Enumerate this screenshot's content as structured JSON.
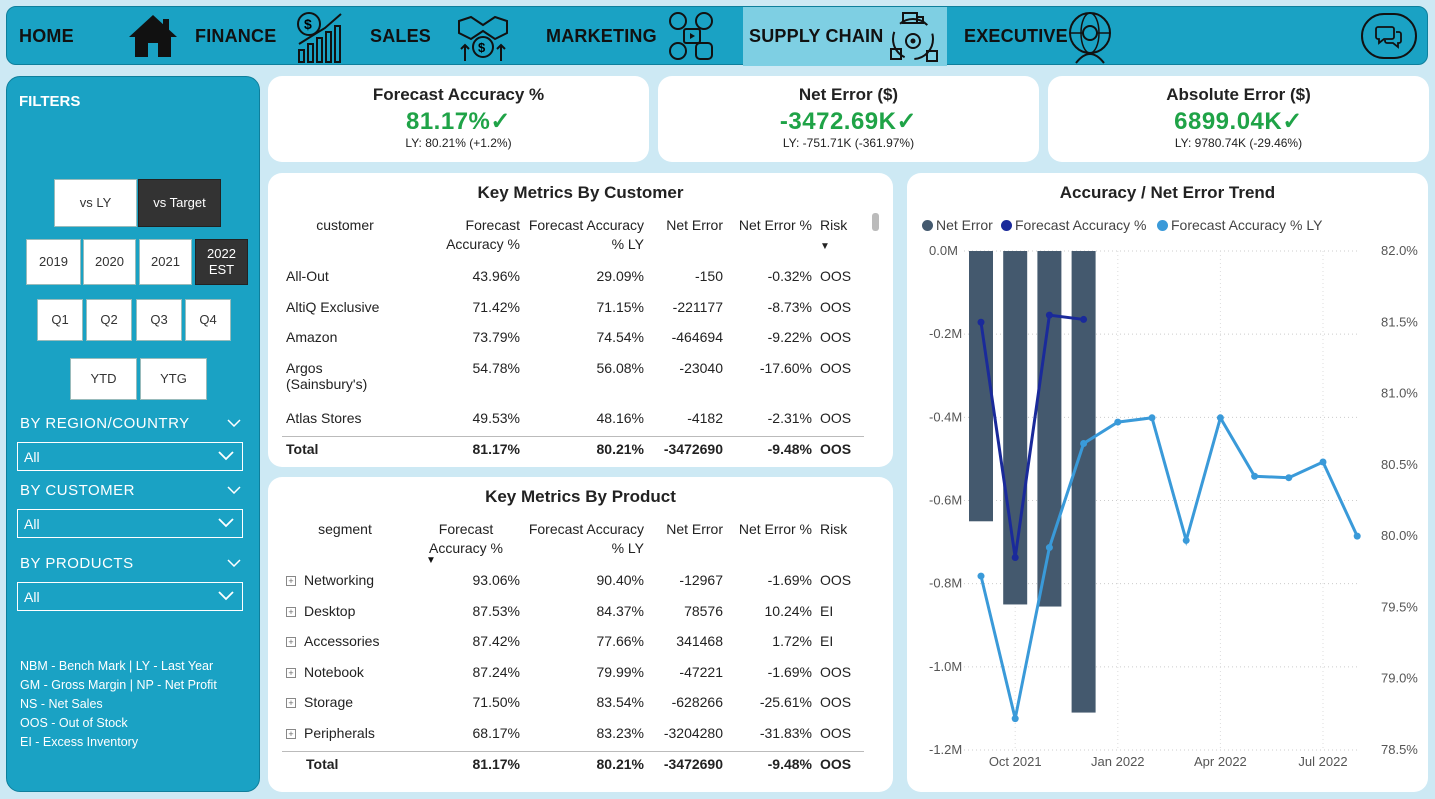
{
  "nav": {
    "items": [
      {
        "label": "HOME",
        "icon": "home-icon"
      },
      {
        "label": "FINANCE",
        "icon": "growth-chart-icon"
      },
      {
        "label": "SALES",
        "icon": "handshake-money-icon"
      },
      {
        "label": "MARKETING",
        "icon": "social-media-icon"
      },
      {
        "label": "SUPPLY CHAIN",
        "icon": "supply-chain-icon",
        "active": true
      },
      {
        "label": "EXECUTIVE",
        "icon": "executive-icon"
      }
    ],
    "help_icon": "chat-help-icon"
  },
  "filters": {
    "title": "FILTERS",
    "compare": [
      "vs LY",
      "vs Target"
    ],
    "compare_selected": "vs Target",
    "years": [
      "2019",
      "2020",
      "2021",
      "2022\nEST"
    ],
    "year_selected": "2022\nEST",
    "quarters": [
      "Q1",
      "Q2",
      "Q3",
      "Q4"
    ],
    "periods": [
      "YTD",
      "YTG"
    ],
    "region": {
      "label": "BY REGION/COUNTRY",
      "value": "All"
    },
    "customer": {
      "label": "BY CUSTOMER",
      "value": "All"
    },
    "products": {
      "label": "BY PRODUCTS",
      "value": "All"
    },
    "legend": [
      "NBM - Bench Mark | LY - Last Year",
      "GM - Gross Margin | NP - Net Profit",
      "NS  - Net Sales",
      "OOS - Out of Stock",
      "EI - Excess Inventory"
    ]
  },
  "kpis": [
    {
      "title": "Forecast Accuracy %",
      "value": "81.17%",
      "sub": "LY: 80.21% (+1.2%)"
    },
    {
      "title": "Net Error ($)",
      "value": "-3472.69K",
      "sub": "LY: -751.71K (-361.97%)"
    },
    {
      "title": "Absolute Error ($)",
      "value": "6899.04K",
      "sub": "LY: 9780.74K (-29.46%)"
    }
  ],
  "customer_table": {
    "title": "Key Metrics By Customer",
    "headers": [
      "customer",
      "Forecast Accuracy %",
      "Forecast Accuracy % LY",
      "Net Error",
      "Net Error %",
      "Risk"
    ],
    "rows": [
      [
        "All-Out",
        "43.96%",
        "29.09%",
        "-150",
        "-0.32%",
        "OOS"
      ],
      [
        "AltiQ Exclusive",
        "71.42%",
        "71.15%",
        "-221177",
        "-8.73%",
        "OOS"
      ],
      [
        "Amazon",
        "73.79%",
        "74.54%",
        "-464694",
        "-9.22%",
        "OOS"
      ],
      [
        "Argos (Sainsbury's)",
        "54.78%",
        "56.08%",
        "-23040",
        "-17.60%",
        "OOS"
      ],
      [
        "Atlas Stores",
        "49.53%",
        "48.16%",
        "-4182",
        "-2.31%",
        "OOS"
      ]
    ],
    "total": [
      "Total",
      "81.17%",
      "80.21%",
      "-3472690",
      "-9.48%",
      "OOS"
    ]
  },
  "product_table": {
    "title": "Key Metrics By Product",
    "headers": [
      "segment",
      "Forecast Accuracy %",
      "Forecast Accuracy % LY",
      "Net Error",
      "Net Error %",
      "Risk"
    ],
    "rows": [
      [
        "Networking",
        "93.06%",
        "90.40%",
        "-12967",
        "-1.69%",
        "OOS"
      ],
      [
        "Desktop",
        "87.53%",
        "84.37%",
        "78576",
        "10.24%",
        "EI"
      ],
      [
        "Accessories",
        "87.42%",
        "77.66%",
        "341468",
        "1.72%",
        "EI"
      ],
      [
        "Notebook",
        "87.24%",
        "79.99%",
        "-47221",
        "-1.69%",
        "OOS"
      ],
      [
        "Storage",
        "71.50%",
        "83.54%",
        "-628266",
        "-25.61%",
        "OOS"
      ],
      [
        "Peripherals",
        "68.17%",
        "83.23%",
        "-3204280",
        "-31.83%",
        "OOS"
      ]
    ],
    "total": [
      "Total",
      "81.17%",
      "80.21%",
      "-3472690",
      "-9.48%",
      "OOS"
    ]
  },
  "chart_data": {
    "type": "bar+line",
    "title": "Accuracy / Net Error Trend",
    "legend_position": "top-left",
    "x_ticks": [
      "Oct 2021",
      "Jan 2022",
      "Apr 2022",
      "Jul 2022"
    ],
    "left_axis": {
      "ticks": [
        "0.0M",
        "-0.2M",
        "-0.4M",
        "-0.6M",
        "-0.8M",
        "-1.0M",
        "-1.2M"
      ],
      "range": [
        -1.2,
        0.0
      ],
      "unit": "M"
    },
    "right_axis": {
      "ticks": [
        "82.0%",
        "81.5%",
        "81.0%",
        "80.5%",
        "80.0%",
        "79.5%",
        "79.0%",
        "78.5%"
      ],
      "range": [
        78.5,
        82.0
      ]
    },
    "series": [
      {
        "name": "Net Error",
        "color": "#44596e",
        "type": "bar",
        "axis": "left",
        "points": [
          [
            -3,
            -0.65
          ],
          [
            -2,
            -0.85
          ],
          [
            -1,
            -0.855
          ],
          [
            0,
            -1.11
          ]
        ]
      },
      {
        "name": "Forecast Accuracy %",
        "color": "#1a2a9a",
        "type": "line",
        "axis": "right",
        "points": [
          [
            -3,
            81.5
          ],
          [
            -2,
            79.85
          ],
          [
            -1,
            81.55
          ],
          [
            0,
            81.52
          ]
        ]
      },
      {
        "name": "Forecast Accuracy % LY",
        "color": "#3a9ad9",
        "type": "line",
        "axis": "right",
        "points": [
          [
            -3,
            79.72
          ],
          [
            -2,
            78.72
          ],
          [
            -1,
            79.92
          ],
          [
            0,
            80.65
          ],
          [
            1,
            80.8
          ],
          [
            2,
            80.83
          ],
          [
            3,
            79.97
          ],
          [
            4,
            80.83
          ],
          [
            5,
            80.42
          ],
          [
            6,
            80.41
          ],
          [
            7,
            80.52
          ],
          [
            8,
            80.0
          ]
        ]
      }
    ],
    "x_tick_index": [
      0,
      3,
      6,
      9
    ]
  }
}
